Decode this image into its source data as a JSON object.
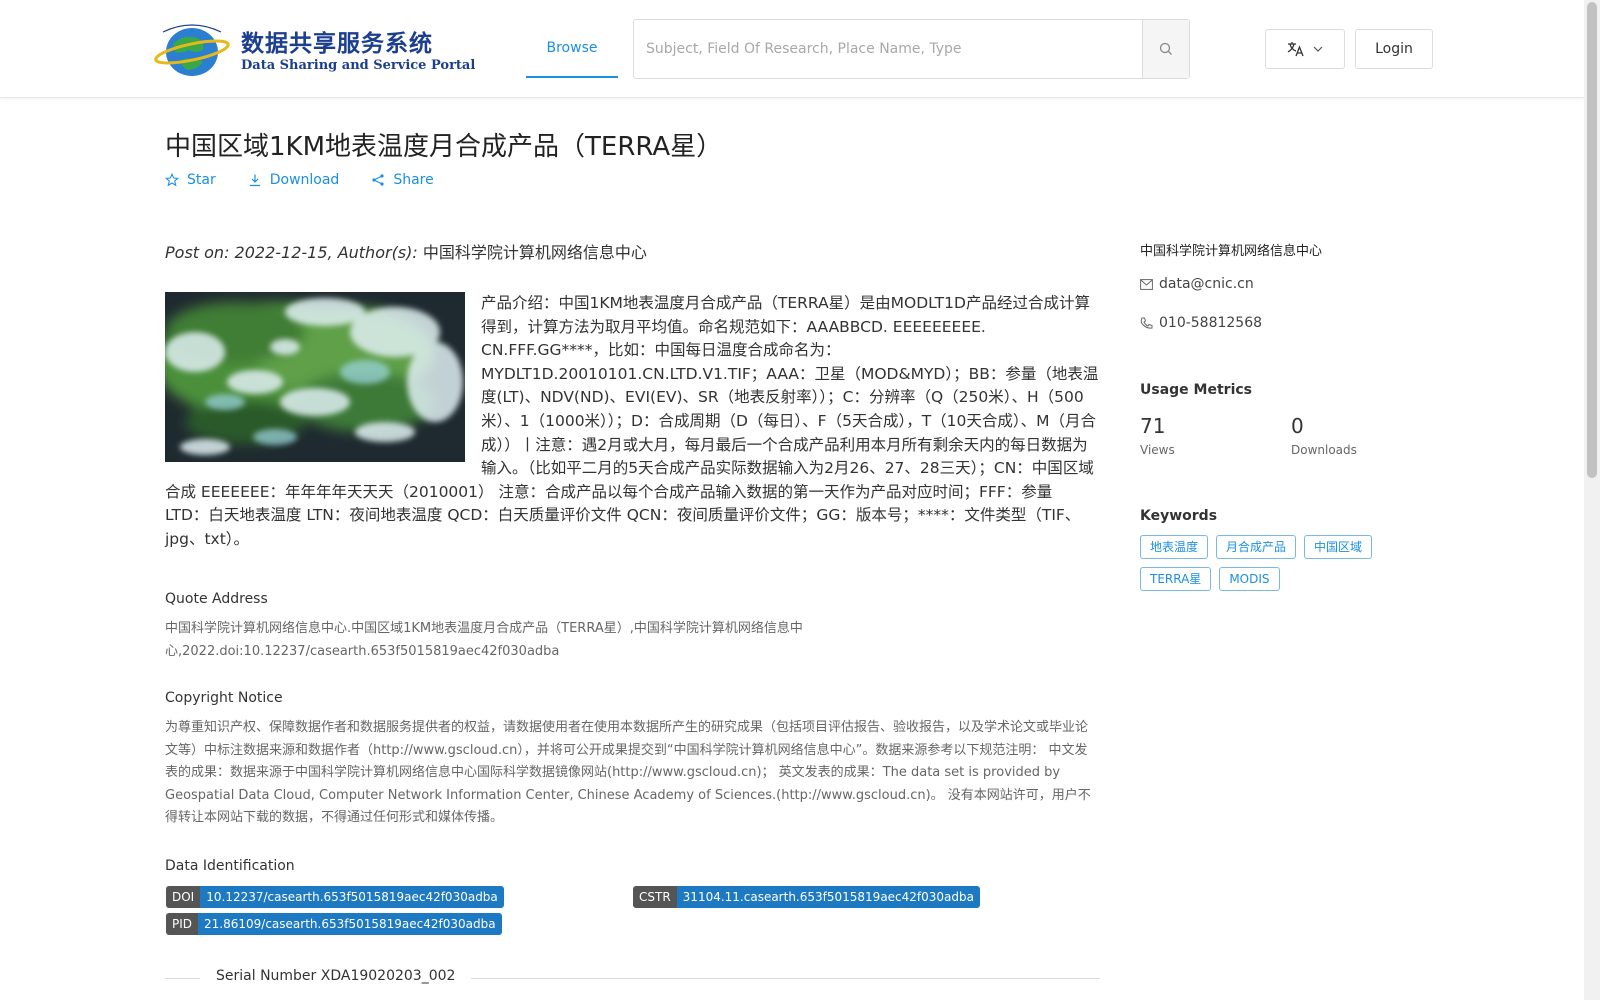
{
  "header": {
    "logo_cn": "数据共享服务系统",
    "logo_en": "Data Sharing and Service Portal",
    "nav_browse": "Browse",
    "search_placeholder": "Subject, Field Of Research, Place Name, Type",
    "login": "Login"
  },
  "dataset": {
    "title": "中国区域1KM地表温度月合成产品（TERRA星）",
    "actions": {
      "star": "Star",
      "download": "Download",
      "share": "Share"
    },
    "post_prefix": "Post on: 2022-12-15, Author(s): ",
    "author": "中国科学院计算机网络信息中心",
    "intro": "产品介绍：中国1KM地表温度月合成产品（TERRA星）是由MODLT1D产品经过合成计算得到，计算方法为取月平均值。命名规范如下：AAABBCD. EEEEEEEEE. CN.FFF.GG****，比如：中国每日温度合成命名为：MYDLT1D.20010101.CN.LTD.V1.TIF；AAA：卫星（MOD&MYD）；BB：参量（地表温度(LT)、NDV(ND)、EVI(EV)、SR（地表反射率））；C：分辨率（Q（250米）、H（500米）、1（1000米））；D：合成周期（D（每日）、F（5天合成），T（10天合成）、M（月合成））丨注意：遇2月或大月，每月最后一个合成产品利用本月所有剩余天内的每日数据为输入。（比如平二月的5天合成产品实际数据输入为2月26、27、28三天）；CN：中国区域合成 EEEEEEE：年年年年天天天（2010001） 注意：合成产品以每个合成产品输入数据的第一天作为产品对应时间；FFF：参量 LTD：白天地表温度 LTN：夜间地表温度 QCD：白天质量评价文件 QCN：夜间质量评价文件；GG：版本号；****：文件类型（TIF、jpg、txt）。",
    "quote_label": "Quote Address",
    "quote_text": "中国科学院计算机网络信息中心.中国区域1KM地表温度月合成产品（TERRA星）,中国科学院计算机网络信息中心,2022.doi:10.12237/casearth.653f5015819aec42f030adba",
    "copyright_label": "Copyright Notice",
    "copyright_text": "为尊重知识产权、保障数据作者和数据服务提供者的权益，请数据使用者在使用本数据所产生的研究成果（包括项目评估报告、验收报告，以及学术论文或毕业论文等）中标注数据来源和数据作者（http://www.gscloud.cn），并将可公开成果提交到“中国科学院计算机网络信息中心”。数据来源参考以下规范注明： 中文发表的成果：数据来源于中国科学院计算机网络信息中心国际科学数据镜像网站(http://www.gscloud.cn)； 英文发表的成果：The data set is provided by Geospatial Data Cloud, Computer Network Information Center, Chinese Academy of Sciences.(http://www.gscloud.cn)。 没有本网站许可，用户不得转让本网站下载的数据，不得通过任何形式和媒体传播。",
    "identification_label": "Data Identification",
    "doi_key": "DOI",
    "doi_val": "10.12237/casearth.653f5015819aec42f030adba",
    "cstr_key": "CSTR",
    "cstr_val": "31104.11.casearth.653f5015819aec42f030adba",
    "pid_key": "PID",
    "pid_val": "21.86109/casearth.653f5015819aec42f030adba",
    "serial": "Serial Number XDA19020203_002"
  },
  "sidebar": {
    "org": "中国科学院计算机网络信息中心",
    "email": "data@cnic.cn",
    "phone": "010-58812568",
    "usage_title": "Usage Metrics",
    "views_value": "71",
    "views_label": "Views",
    "downloads_value": "0",
    "downloads_label": "Downloads",
    "keywords_title": "Keywords",
    "keywords": [
      "地表温度",
      "月合成产品",
      "中国区域",
      "TERRA星",
      "MODIS"
    ]
  },
  "colors": {
    "accent": "#1a8fe3",
    "badge_value": "#1d79c2",
    "badge_key": "#555555"
  },
  "icons": [
    "globe-logo-icon",
    "search-icon",
    "translate-icon",
    "chevron-down-icon",
    "star-icon",
    "download-icon",
    "share-icon",
    "mail-icon",
    "phone-icon"
  ]
}
